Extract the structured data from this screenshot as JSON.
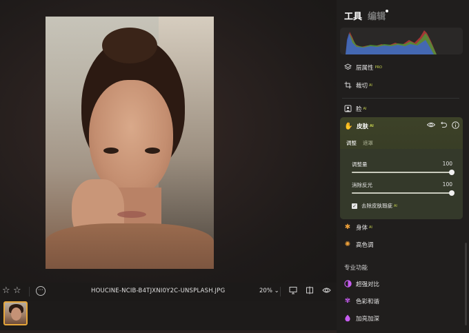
{
  "file": {
    "name": "HOUCINE-NCIB-B4TJXNI0Y2C-UNSPLASH.JPG"
  },
  "toolbar": {
    "zoom": "20%",
    "zoom_arrow": "⌄"
  },
  "panel": {
    "tabs": {
      "tools": "工具",
      "edit": "编辑"
    },
    "tools_list": [
      {
        "label": "层属性",
        "badge": "PRO",
        "icon": "layers-icon"
      },
      {
        "label": "裁切",
        "badge": "AI",
        "icon": "crop-icon"
      },
      {
        "label": "脸",
        "badge": "AI",
        "icon": "face-icon"
      }
    ],
    "skin": {
      "title": "皮肤",
      "badge": "AI",
      "subtabs": {
        "adjust": "调整",
        "mask": "遮罩"
      },
      "sliders": [
        {
          "label": "调整量",
          "value": "100",
          "fraction": 1.0
        },
        {
          "label": "消除反光",
          "value": "100",
          "fraction": 1.0
        }
      ],
      "checkbox": {
        "label": "去除皮肤瑕疵",
        "badge": "AI",
        "checked": true
      }
    },
    "after": [
      {
        "label": "身体",
        "badge": "AI",
        "icon": "body-icon"
      },
      {
        "label": "高色调",
        "badge": "",
        "icon": "high-key-icon"
      }
    ],
    "pro_section": "专业功能",
    "pro_list": [
      {
        "label": "超强对比",
        "icon": "contrast-icon"
      },
      {
        "label": "色彩和谐",
        "icon": "color-harmony-icon"
      },
      {
        "label": "加亮加深",
        "icon": "dodge-burn-icon"
      }
    ]
  },
  "colors": {
    "accent": "#e6a73a",
    "skin_card": "#3d4228",
    "pro_icon": "#c65cf0",
    "body_icon": "#f0a23a"
  }
}
